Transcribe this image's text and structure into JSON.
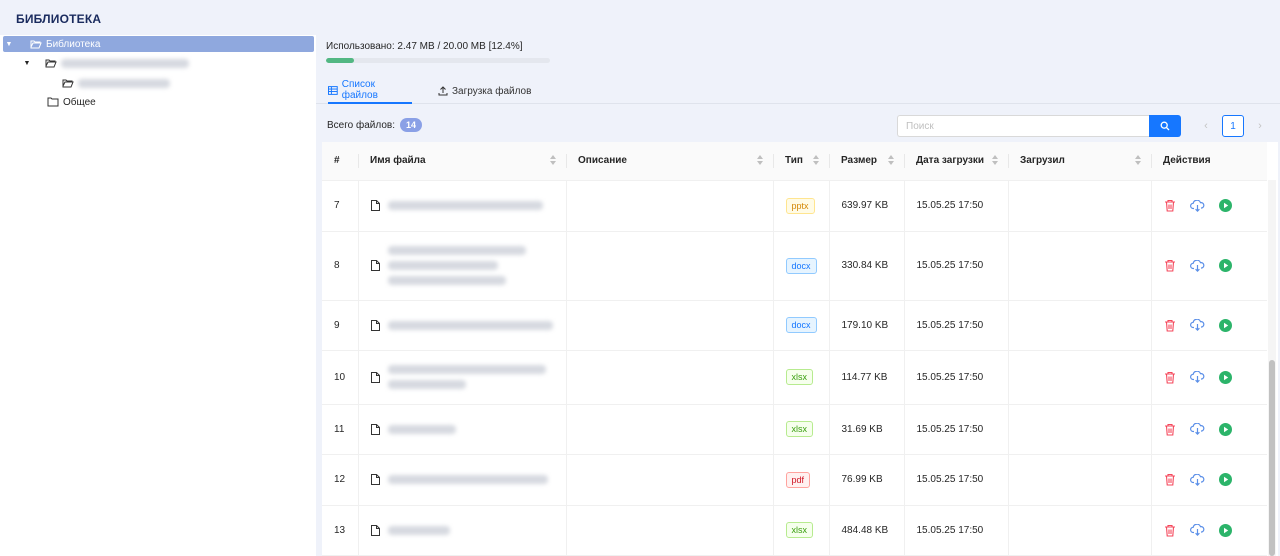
{
  "page": {
    "title": "БИБЛИОТЕКА"
  },
  "sidebar": {
    "root_label": "Библиотека",
    "common_label": "Общее"
  },
  "usage": {
    "text": "Использовано: 2.47 MB / 20.00 MB [12.4%]",
    "percent": 12.4
  },
  "tabs": [
    {
      "label": "Список файлов"
    },
    {
      "label": "Загрузка файлов"
    }
  ],
  "toolbar": {
    "total_label": "Всего файлов:",
    "total_count": "14",
    "search_placeholder": "Поиск",
    "current_page": "1"
  },
  "table": {
    "headers": {
      "num": "#",
      "name": "Имя файла",
      "desc": "Описание",
      "type": "Тип",
      "size": "Размер",
      "date": "Дата загрузки",
      "uploader": "Загрузил",
      "actions": "Действия"
    },
    "rows": [
      {
        "num": "7",
        "type": "pptx",
        "size": "639.97 KB",
        "date": "15.05.25 17:50"
      },
      {
        "num": "8",
        "type": "docx",
        "size": "330.84 KB",
        "date": "15.05.25 17:50"
      },
      {
        "num": "9",
        "type": "docx",
        "size": "179.10 KB",
        "date": "15.05.25 17:50"
      },
      {
        "num": "10",
        "type": "xlsx",
        "size": "114.77 KB",
        "date": "15.05.25 17:50"
      },
      {
        "num": "11",
        "type": "xlsx",
        "size": "31.69 KB",
        "date": "15.05.25 17:50"
      },
      {
        "num": "12",
        "type": "pdf",
        "size": "76.99 KB",
        "date": "15.05.25 17:50"
      },
      {
        "num": "13",
        "type": "xlsx",
        "size": "484.48 KB",
        "date": "15.05.25 17:50"
      }
    ]
  },
  "colors": {
    "accent": "#1677ff",
    "progress": "#52b783",
    "delete": "#f5475b",
    "download": "#5b8fe8",
    "play": "#2cb46a"
  }
}
